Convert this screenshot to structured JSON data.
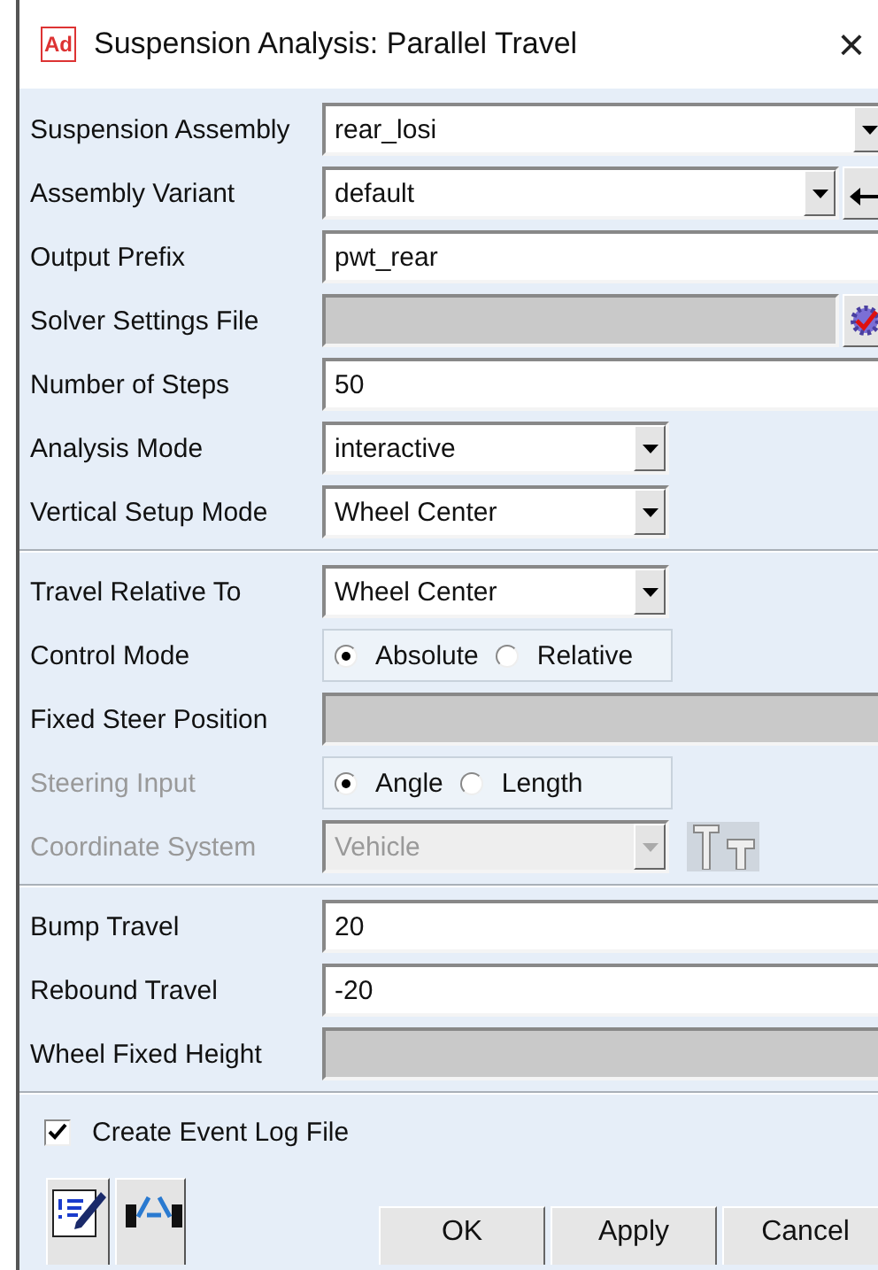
{
  "window": {
    "app_badge": "Ad",
    "title": "Suspension Analysis: Parallel Travel",
    "close": "×"
  },
  "sections": [
    {
      "rows": [
        {
          "label": "Suspension Assembly",
          "kind": "combo",
          "value": "rear_losi",
          "disabled": false
        },
        {
          "label": "Assembly Variant",
          "kind": "combo_enter",
          "value": "default",
          "disabled": false
        },
        {
          "label": "Output Prefix",
          "kind": "text",
          "value": "pwt_rear",
          "disabled": false
        },
        {
          "label": "Solver Settings File",
          "kind": "file",
          "disabled": false
        },
        {
          "label": "Number of Steps",
          "kind": "text",
          "value": "50",
          "disabled": false
        },
        {
          "label": "Analysis Mode",
          "kind": "select",
          "value": "interactive",
          "disabled": false
        },
        {
          "label": "Vertical Setup Mode",
          "kind": "select",
          "value": "Wheel Center",
          "disabled": false
        }
      ]
    },
    {
      "rows": [
        {
          "label": "Travel Relative To",
          "kind": "select",
          "value": "Wheel Center",
          "disabled": false
        },
        {
          "label": "Control Mode",
          "kind": "radio",
          "disabled": false,
          "options": [
            {
              "label": "Absolute",
              "selected": true
            },
            {
              "label": "Relative",
              "selected": false
            }
          ]
        },
        {
          "label": "Fixed Steer Position",
          "kind": "blank",
          "disabled": false
        },
        {
          "label": "Steering Input",
          "kind": "radio",
          "disabled": true,
          "options": [
            {
              "label": "Angle",
              "selected": true
            },
            {
              "label": "Length",
              "selected": false
            }
          ]
        },
        {
          "label": "Coordinate System",
          "kind": "select_tool",
          "value": "Vehicle",
          "disabled": true
        }
      ]
    },
    {
      "rows": [
        {
          "label": "Bump Travel",
          "kind": "text",
          "value": "20",
          "disabled": false
        },
        {
          "label": "Rebound Travel",
          "kind": "text",
          "value": "-20",
          "disabled": false
        },
        {
          "label": "Wheel Fixed Height",
          "kind": "blank",
          "disabled": false
        }
      ]
    }
  ],
  "checkbox": {
    "label": "Create Event Log File",
    "checked": true
  },
  "buttons": [
    "OK",
    "Apply",
    "Cancel"
  ]
}
